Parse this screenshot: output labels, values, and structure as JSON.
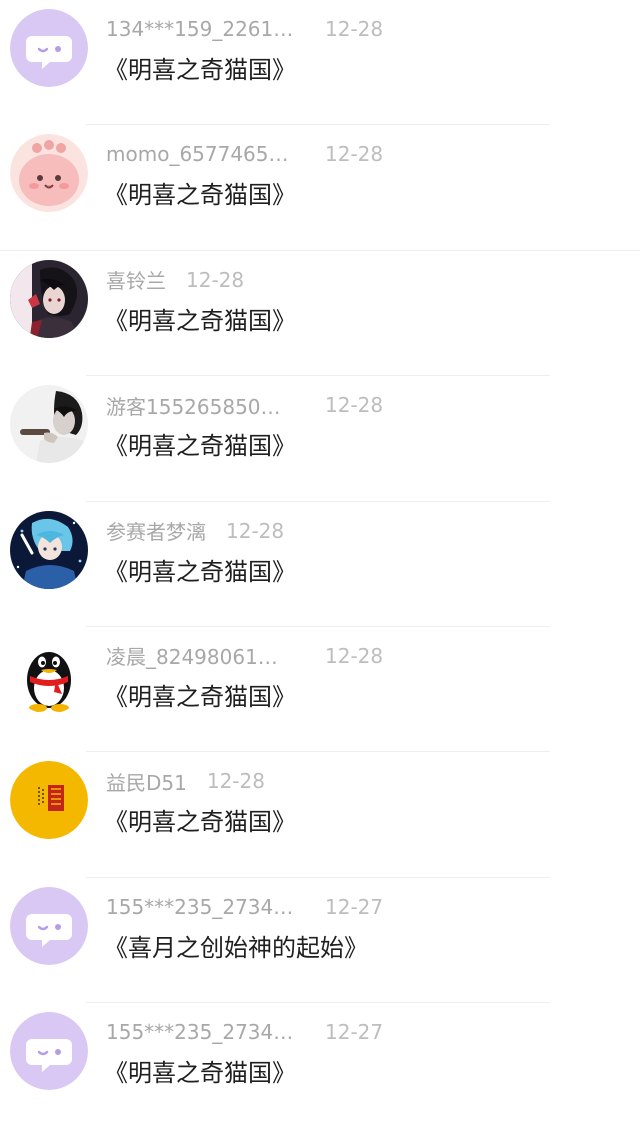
{
  "items": [
    {
      "name": "134***159_2261…",
      "date": "12-28",
      "title": "《明喜之奇猫国》",
      "avatar": "default-chat-avatar"
    },
    {
      "name": "momo_6577465…",
      "date": "12-28",
      "title": "《明喜之奇猫国》",
      "avatar": "pink-blob-avatar"
    },
    {
      "name": "喜铃兰",
      "date": "12-28",
      "title": "《明喜之奇猫国》",
      "avatar": "anime-portrait-avatar"
    },
    {
      "name": "游客155265850…",
      "date": "12-28",
      "title": "《明喜之奇猫国》",
      "avatar": "grayscale-photo-avatar"
    },
    {
      "name": "参赛者梦漓",
      "date": "12-28",
      "title": "《明喜之奇猫国》",
      "avatar": "anime-blue-avatar"
    },
    {
      "name": "凌晨_82498061…",
      "date": "12-28",
      "title": "《明喜之奇猫国》",
      "avatar": "qq-penguin-avatar"
    },
    {
      "name": "益民D51",
      "date": "12-28",
      "title": "《明喜之奇猫国》",
      "avatar": "yellow-stamp-avatar"
    },
    {
      "name": "155***235_2734…",
      "date": "12-27",
      "title": "《喜月之创始神的起始》",
      "avatar": "default-chat-avatar"
    },
    {
      "name": "155***235_2734…",
      "date": "12-27",
      "title": "《明喜之奇猫国》",
      "avatar": "default-chat-avatar"
    }
  ],
  "colors": {
    "default_avatar_bg": "#d9c8f4",
    "default_avatar_bubble": "#ffffff",
    "default_avatar_face": "#b69ce6",
    "pink_avatar_bg": "#f9c2c2",
    "yellow_avatar_bg": "#f5b800"
  }
}
